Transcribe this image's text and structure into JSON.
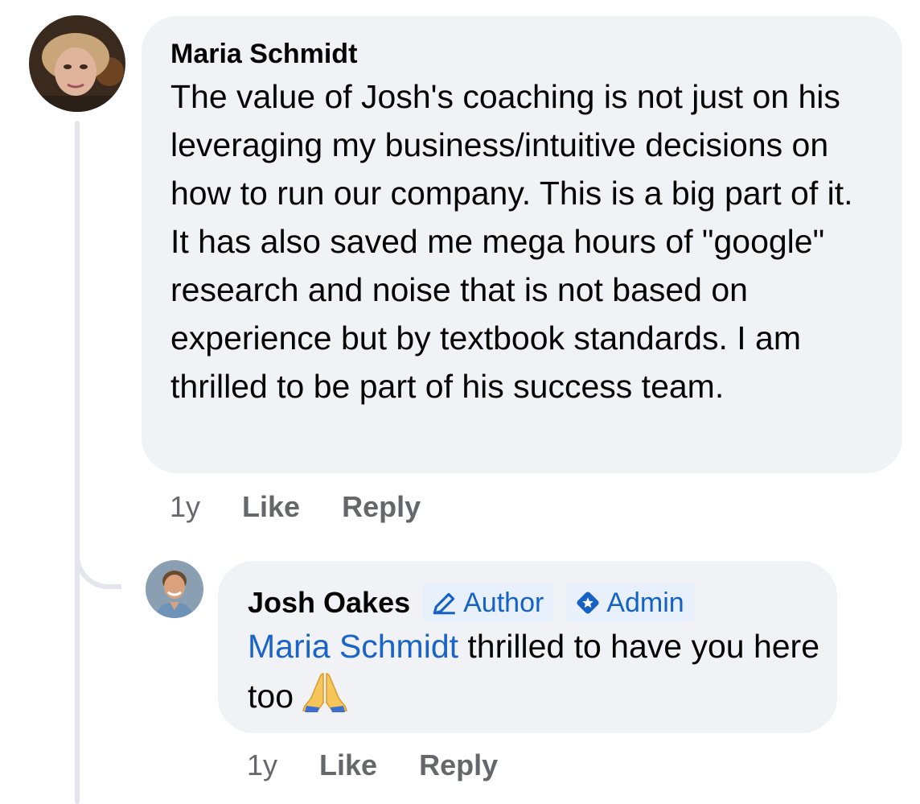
{
  "comment": {
    "author": "Maria Schmidt",
    "text": "The value of Josh's coaching is not just on his leveraging my business/intuitive decisions on how to run our company. This is a big part of it. It has also saved me mega hours of \"google\" research and noise that is not based on experience but by textbook standards. I am thrilled to be part of his success team.",
    "time": "1y",
    "like_label": "Like",
    "reply_label": "Reply"
  },
  "reply": {
    "author": "Josh Oakes",
    "badges": [
      "Author",
      "Admin"
    ],
    "mention": "Maria Schmidt",
    "text": " thrilled to have you here too",
    "emoji": "folded-hands",
    "time": "1y",
    "like_label": "Like",
    "reply_label": "Reply"
  },
  "colors": {
    "bubble": "#f0f2f5",
    "link": "#1a64c8",
    "badge_bg": "#e7f0fb",
    "meta_text": "#65676b"
  }
}
